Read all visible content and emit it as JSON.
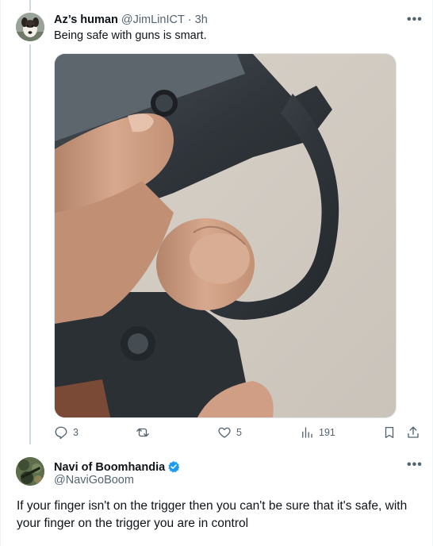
{
  "tweet1": {
    "author_name": "Az’s human",
    "author_handle": "@JimLinICT",
    "separator": "·",
    "time": "3h",
    "text": "Being safe with guns is smart.",
    "media_alt": "",
    "actions": {
      "replies": "3",
      "retweets": "",
      "likes": "5",
      "views": "191"
    },
    "more": "•••"
  },
  "tweet2": {
    "author_name": "Navi of Boomhandia",
    "verified": true,
    "author_handle": "@NaviGoBoom",
    "text": "If your finger isn't on the trigger then you can't be sure that it's safe, with your finger on the trigger you are in control",
    "more": "•••"
  },
  "colors": {
    "text_primary": "#0f1419",
    "text_secondary": "#536471",
    "verified_blue": "#1d9bf0",
    "thread_line": "#cfd9de"
  },
  "icons": [
    "reply-icon",
    "retweet-icon",
    "like-icon",
    "views-icon",
    "bookmark-icon",
    "share-icon",
    "verified-badge-icon",
    "more-icon"
  ]
}
